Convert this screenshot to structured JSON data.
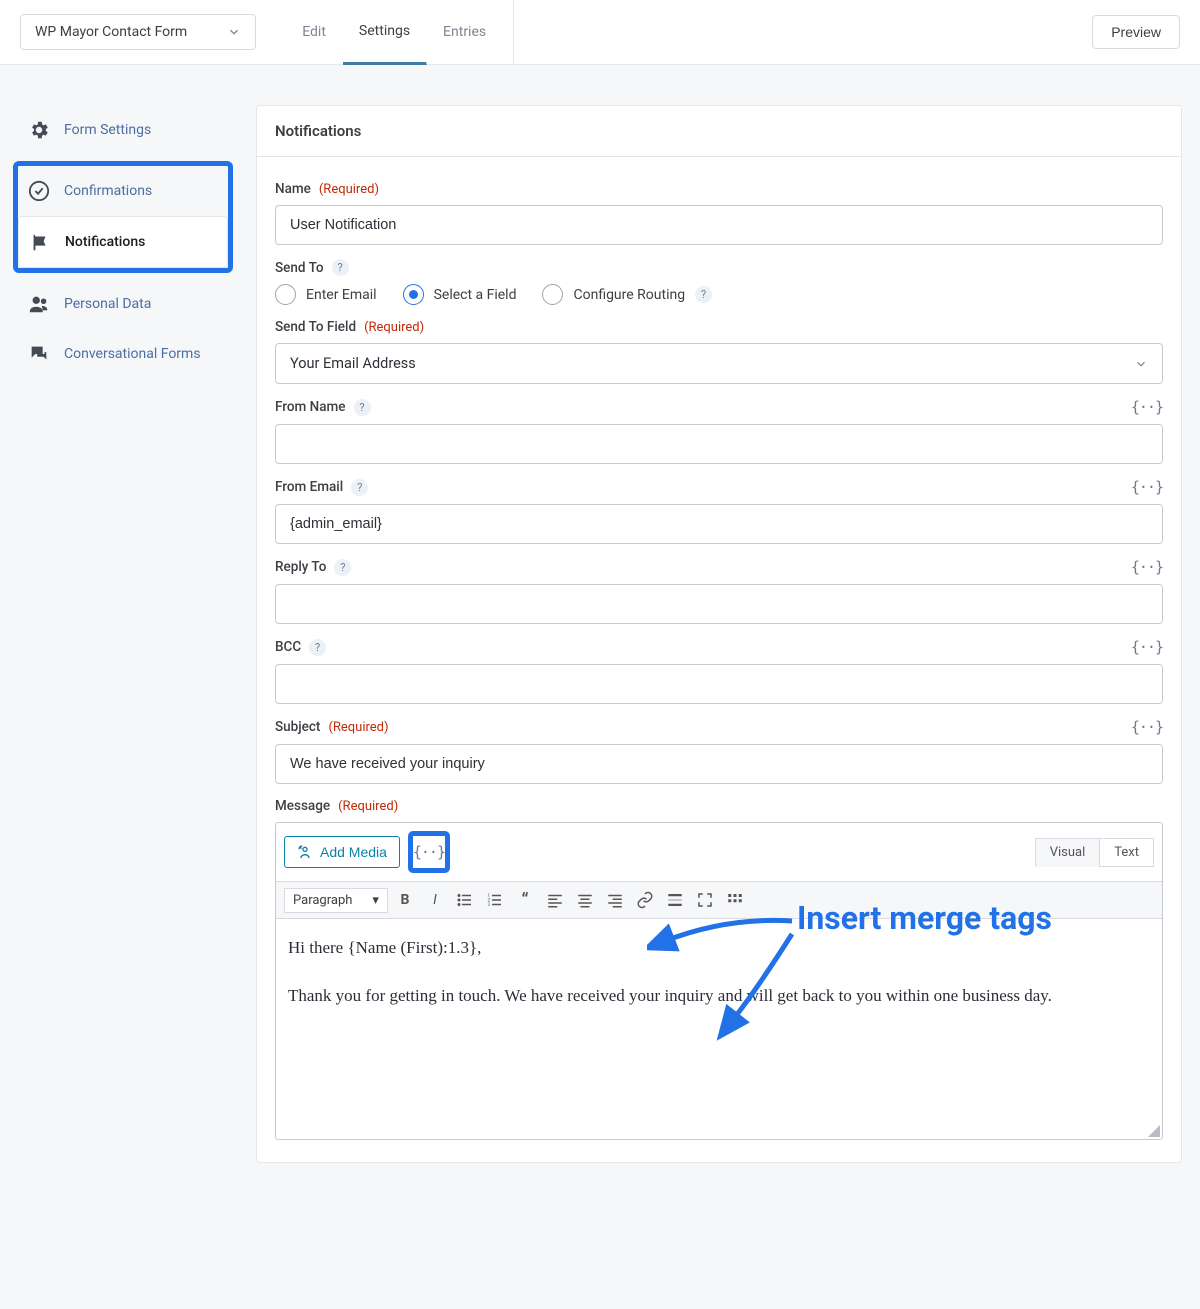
{
  "topbar": {
    "form_name": "WP Mayor Contact Form",
    "tabs": {
      "edit": "Edit",
      "settings": "Settings",
      "entries": "Entries"
    },
    "preview_label": "Preview"
  },
  "sidebar": {
    "items": [
      {
        "label": "Form Settings"
      },
      {
        "label": "Confirmations"
      },
      {
        "label": "Notifications"
      },
      {
        "label": "Personal Data"
      },
      {
        "label": "Conversational Forms"
      }
    ]
  },
  "panel": {
    "header": "Notifications",
    "name_label": "Name",
    "required_text": "(Required)",
    "name_value": "User Notification",
    "send_to_label": "Send To",
    "send_to_options": {
      "enter_email": "Enter Email",
      "select_field": "Select a Field",
      "configure_routing": "Configure Routing"
    },
    "send_to_field_label": "Send To Field",
    "send_to_field_value": "Your Email Address",
    "from_name_label": "From Name",
    "from_name_value": "",
    "from_email_label": "From Email",
    "from_email_value": "{admin_email}",
    "reply_to_label": "Reply To",
    "reply_to_value": "",
    "bcc_label": "BCC",
    "bcc_value": "",
    "subject_label": "Subject",
    "subject_value": "We have received your inquiry",
    "message_label": "Message",
    "add_media_label": "Add Media",
    "merge_tag_symbol": "{··}",
    "editor_tabs": {
      "visual": "Visual",
      "text": "Text"
    },
    "paragraph_label": "Paragraph",
    "message_content": {
      "p1": "Hi there {Name (First):1.3},",
      "p2": "Thank you for getting in touch. We have received your inquiry and will get back to you within one business day."
    }
  },
  "annotation_text": "Insert merge tags"
}
